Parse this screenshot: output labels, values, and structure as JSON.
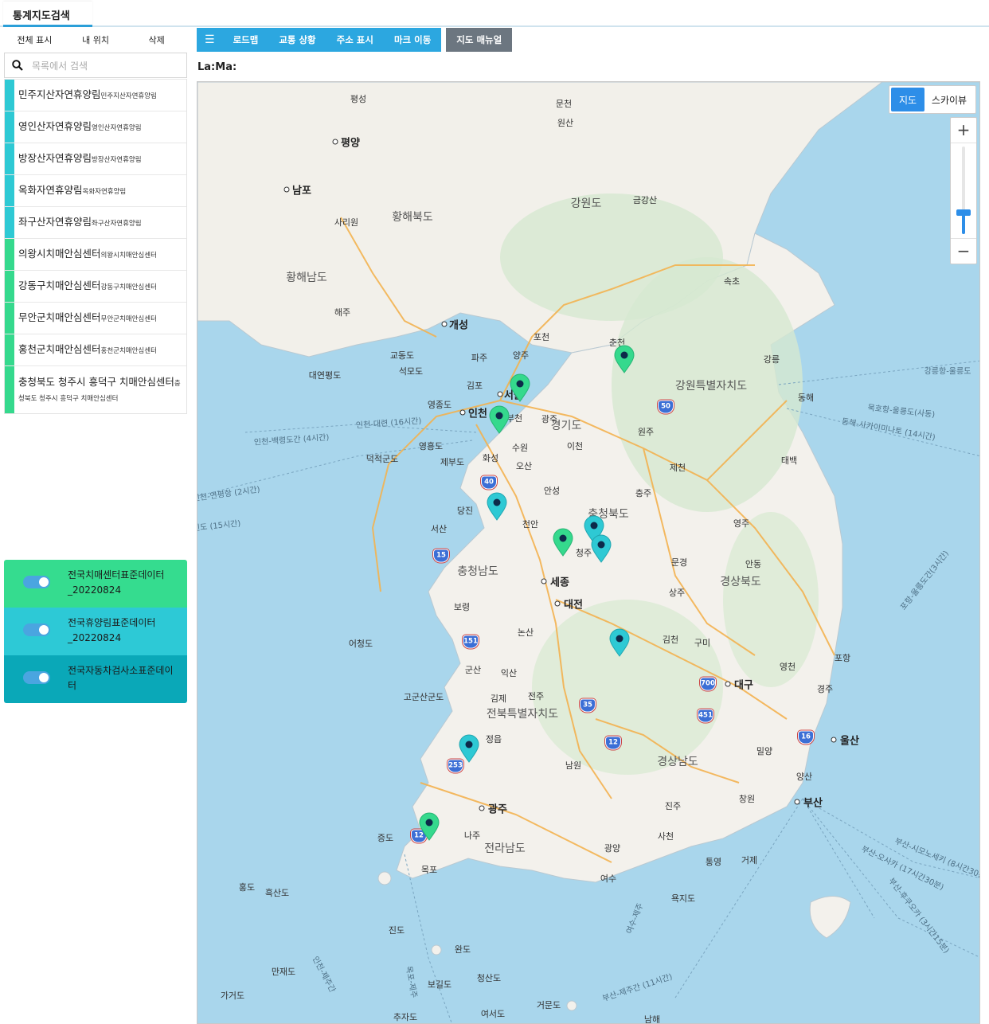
{
  "top_tab": {
    "label": "통계지도검색"
  },
  "left_actions": {
    "show_all": "전체 표시",
    "my_location": "내 위치",
    "delete": "삭제"
  },
  "search": {
    "placeholder": "목록에서 검색",
    "value": ""
  },
  "poi_list": [
    {
      "title": "민주지산자연휴양림",
      "sub": "민주지산자연휴양림",
      "color": "#2ec9d4"
    },
    {
      "title": "영인산자연휴양림",
      "sub": "영인산자연휴양림",
      "color": "#2ec9d4"
    },
    {
      "title": "방장산자연휴양림",
      "sub": "방장산자연휴양림",
      "color": "#2ec9d4"
    },
    {
      "title": "옥화자연휴양림",
      "sub": "옥화자연휴양림",
      "color": "#2ec9d4"
    },
    {
      "title": "좌구산자연휴양림",
      "sub": "좌구산자연휴양림",
      "color": "#2ec9d4"
    },
    {
      "title": "의왕시치매안심센터",
      "sub": "의왕시치매안심센터",
      "color": "#35d98d"
    },
    {
      "title": "강동구치매안심센터",
      "sub": "강동구치매안심센터",
      "color": "#35d98d"
    },
    {
      "title": "무안군치매안심센터",
      "sub": "무안군치매안심센터",
      "color": "#35d98d"
    },
    {
      "title": "홍천군치매안심센터",
      "sub": "홍천군치매안심센터",
      "color": "#35d98d"
    },
    {
      "title": "충청북도 청주시 흥덕구 치매안심센터",
      "sub": "충청북도 청주시 흥덕구 치매안심센터",
      "color": "#35d98d"
    }
  ],
  "layers": [
    {
      "label": "전국치매센터표준데이터_20220824",
      "color": "#35dc8f",
      "enabled": true
    },
    {
      "label": "전국휴양림표준데이터_20220824",
      "color": "#2dc9d6",
      "enabled": true
    },
    {
      "label": "전국자동차검사소표준데이터",
      "color": "#0aa8b8",
      "enabled": true
    }
  ],
  "toolbar": {
    "menu_icon": "menu-icon",
    "roadmap": "로드맵",
    "traffic": "교통 상황",
    "address": "주소 표시",
    "mark_move": "마크 이동",
    "manual": "지도 매뉴얼"
  },
  "latlng": "La:Ma:",
  "map_type": {
    "map": "지도",
    "skyview": "스카이뷰"
  },
  "zoom": {
    "in": "+",
    "out": "−"
  },
  "colors": {
    "accent": "#2ca7e0",
    "marker_green": "#35d98d",
    "marker_cyan": "#2ec9d4",
    "sea": "#a9d6ec",
    "land": "#f3f1ec",
    "road": "#f3b250"
  },
  "map": {
    "cities": [
      "평양",
      "남포",
      "개성",
      "인천",
      "서울",
      "세종",
      "대전",
      "대구",
      "울산",
      "광주",
      "부산"
    ],
    "provinces": [
      "황해북도",
      "황해남도",
      "강원도",
      "강원특별자치도",
      "경기도",
      "충청북도",
      "충청남도",
      "경상북도",
      "전북특별자치도",
      "경상남도",
      "전라남도"
    ],
    "towns": [
      "평성",
      "문천",
      "원산",
      "금강산",
      "사리원",
      "해주",
      "속초",
      "강릉",
      "동해",
      "춘천",
      "포천",
      "파주",
      "양주",
      "교동도",
      "석모도",
      "대연평도",
      "김포",
      "영종도",
      "부천",
      "광주",
      "영흥도",
      "수원",
      "화성",
      "제부도",
      "덕적군도",
      "오산",
      "이천",
      "원주",
      "안성",
      "충주",
      "제천",
      "태백",
      "당진",
      "서산",
      "천안",
      "청주",
      "영주",
      "문경",
      "안동",
      "상주",
      "보령",
      "논산",
      "김천",
      "구미",
      "포항",
      "어청도",
      "군산",
      "익산",
      "영천",
      "경주",
      "고군산군도",
      "김제",
      "전주",
      "정읍",
      "남원",
      "밀양",
      "양산",
      "창원",
      "진주",
      "증도",
      "나주",
      "목포",
      "광양",
      "사천",
      "통영",
      "거제",
      "홍도",
      "흑산도",
      "여수",
      "욕지도",
      "진도",
      "완도",
      "만재도",
      "청산도",
      "보길도",
      "가거도",
      "거문도",
      "추자도",
      "여서도",
      "남해"
    ],
    "ferries": [
      "강릉항-울릉도",
      "묵호항-울릉도(사동)",
      "동해-사카이미나토 (14시간)",
      "인천-대련 (16시간)",
      "인천-백령도간 (4시간)",
      "인천-연평항 (2시간)",
      "목포-제주",
      "인천-제주간",
      "여수-제주",
      "부산-제주간 (11시간)",
      "부산-시모노세키 (8시간30분)",
      "부산-오사카 (17시간30분)",
      "부산-후쿠오카 (3시간15분)",
      "포항-울릉도간(3시간)",
      "진도 (15시간)"
    ],
    "route_shields": [
      "50",
      "40",
      "15",
      "151",
      "35",
      "700",
      "451",
      "16",
      "12",
      "253",
      "12"
    ]
  }
}
